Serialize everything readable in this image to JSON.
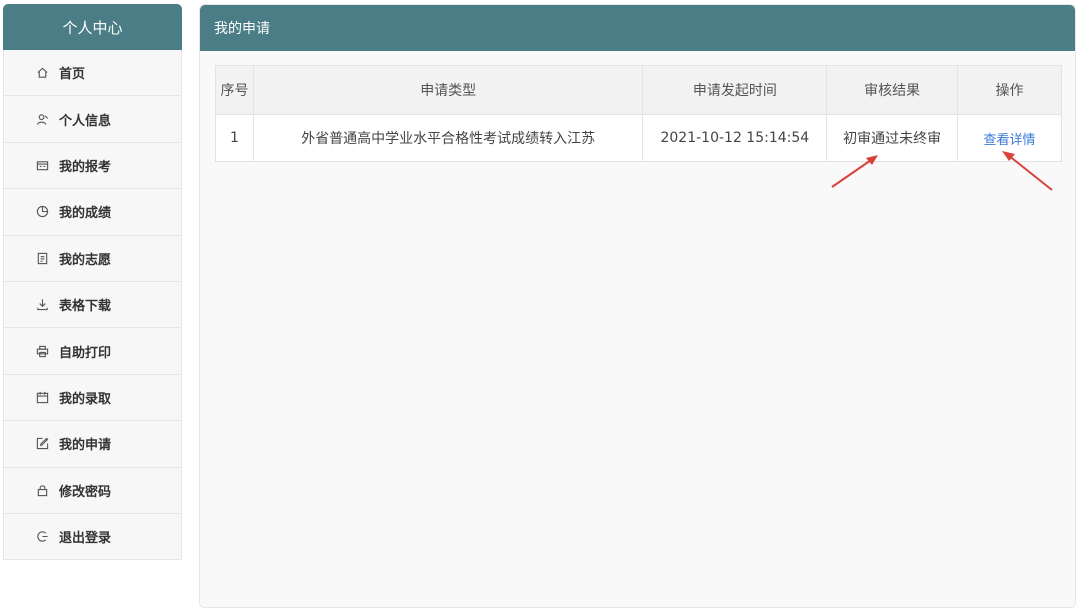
{
  "sidebar": {
    "title": "个人中心",
    "items": [
      {
        "label": "首页",
        "icon": "home-icon"
      },
      {
        "label": "个人信息",
        "icon": "user-icon"
      },
      {
        "label": "我的报考",
        "icon": "id-card-icon"
      },
      {
        "label": "我的成绩",
        "icon": "pie-chart-icon"
      },
      {
        "label": "我的志愿",
        "icon": "document-icon"
      },
      {
        "label": "表格下载",
        "icon": "download-icon"
      },
      {
        "label": "自助打印",
        "icon": "printer-icon"
      },
      {
        "label": "我的录取",
        "icon": "calendar-icon"
      },
      {
        "label": "我的申请",
        "icon": "edit-icon"
      },
      {
        "label": "修改密码",
        "icon": "lock-icon"
      },
      {
        "label": "退出登录",
        "icon": "logout-icon"
      }
    ]
  },
  "main": {
    "title": "我的申请",
    "table": {
      "headers": [
        "序号",
        "申请类型",
        "申请发起时间",
        "审核结果",
        "操作"
      ],
      "rows": [
        {
          "index": "1",
          "type": "外省普通高中学业水平合格性考试成绩转入江苏",
          "time": "2021-10-12 15:14:54",
          "result": "初审通过未终审",
          "action": "查看详情"
        }
      ]
    }
  },
  "colors": {
    "header_bg": "#4a7d85",
    "link": "#3a7bd5",
    "annotation_arrow": "#d9413a"
  }
}
